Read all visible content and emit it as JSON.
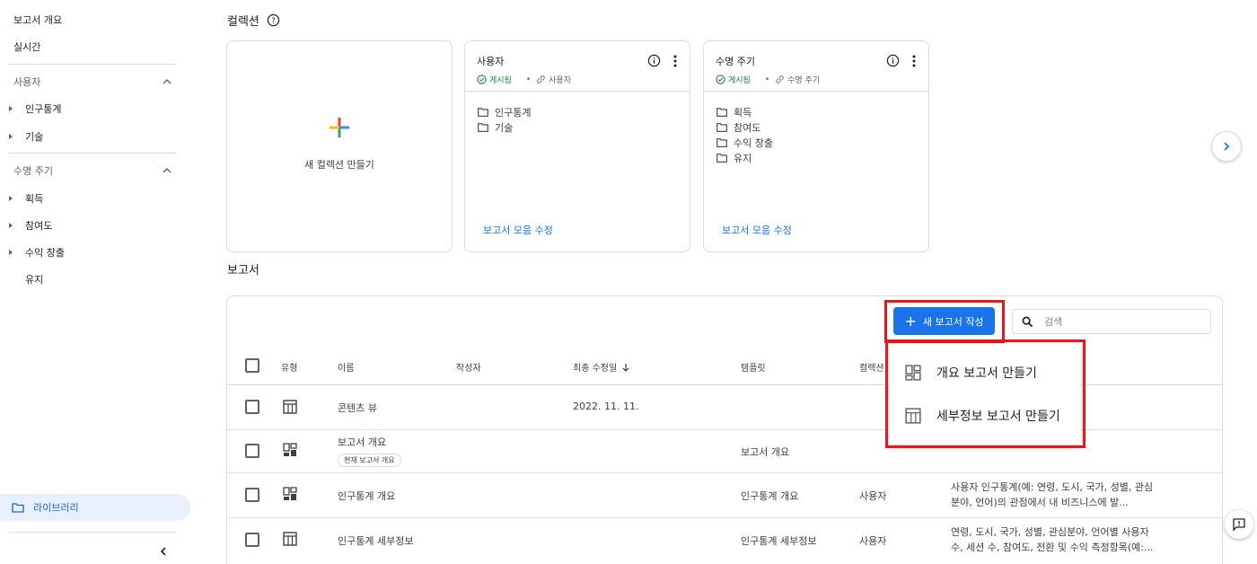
{
  "sidebar": {
    "overview": "보고서 개요",
    "realtime": "실시간",
    "sections": [
      {
        "title": "사용자",
        "items": [
          "인구통계",
          "기술"
        ]
      },
      {
        "title": "수명 주기",
        "items": [
          "획득",
          "참여도",
          "수익 창출",
          "유지"
        ]
      }
    ],
    "library": "라이브러리"
  },
  "collections": {
    "title": "컬렉션",
    "new_label": "새 컬렉션 만들기",
    "cards": [
      {
        "title": "사용자",
        "status": "게시됨",
        "link": "사용자",
        "folders": [
          "인구통계",
          "기술"
        ],
        "edit": "보고서 모음 수정"
      },
      {
        "title": "수명 주기",
        "status": "게시됨",
        "link": "수명 주기",
        "folders": [
          "획득",
          "참여도",
          "수익 창출",
          "유지"
        ],
        "edit": "보고서 모음 수정"
      }
    ]
  },
  "reports": {
    "title": "보고서",
    "new_button": "새 보고서 작성",
    "search_placeholder": "검색",
    "columns": {
      "type": "유형",
      "name": "이름",
      "author": "작성자",
      "modified": "최종 수정일",
      "template": "템플릿",
      "collection": "컬렉션"
    },
    "rows": [
      {
        "icon": "table-icon",
        "name": "콘텐츠 뷰",
        "chip": "",
        "modified": "2022. 11. 11.",
        "template": "",
        "collection": "",
        "desc1": "",
        "desc2": ""
      },
      {
        "icon": "dashboard-icon",
        "name": "보고서 개요",
        "chip": "현재 보고서 개요",
        "modified": "",
        "template": "보고서 개요",
        "collection": "",
        "desc1": "",
        "desc2": ""
      },
      {
        "icon": "dashboard-icon",
        "name": "인구통계 개요",
        "chip": "",
        "modified": "",
        "template": "인구통계 개요",
        "collection": "사용자",
        "desc1": "사용자 인구통계(예: 연령, 도시, 국가, 성별, 관심",
        "desc2": "분야, 언어)의 관점에서 내 비즈니스에 발..."
      },
      {
        "icon": "table-icon",
        "name": "인구통계 세부정보",
        "chip": "",
        "modified": "",
        "template": "인구통계 세부정보",
        "collection": "사용자",
        "desc1": "연령, 도시, 국가, 성별, 관심분야, 언어별 사용자",
        "desc2": "수, 세션 수, 참여도, 전환 및 수익 측정항목(예:..."
      }
    ]
  },
  "menu": {
    "overview_report": "개요 보고서 만들기",
    "detail_report": "세부정보 보고서 만들기"
  },
  "colors": {
    "accent": "#1a73e8",
    "highlight": "#e8161d",
    "published": "#188038"
  }
}
